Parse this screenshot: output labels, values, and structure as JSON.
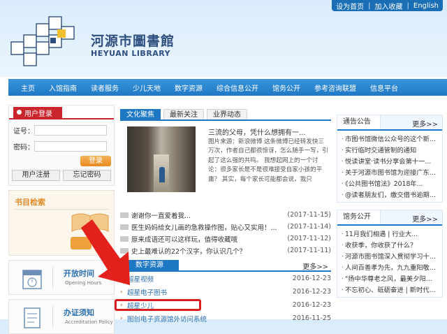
{
  "top_links": [
    "设为首页",
    "加入收藏",
    "English"
  ],
  "logo": {
    "name_cn": "河源市圖書館",
    "name_en": "HEYUAN LIBRARY"
  },
  "nav": [
    "主页",
    "入馆指南",
    "读者服务",
    "少儿天地",
    "数字资源",
    "综合信息公开",
    "馆务公开",
    "参考咨询联盟",
    "信息平台"
  ],
  "login": {
    "title": "用户登录",
    "card_label": "证号：",
    "password_label": "密码：",
    "login_button": "登录",
    "register_button": "用户注册",
    "forgot_button": "忘记密码"
  },
  "catalog": {
    "title": "书目检索"
  },
  "opening_hours": {
    "title": "开放时间",
    "subtitle": "Opening Hours"
  },
  "accreditation": {
    "title": "办证须知",
    "subtitle": "Accreditation Policy"
  },
  "center_tabs": [
    "文化聚焦",
    "最新关注",
    "业界动态"
  ],
  "feature": {
    "title": "三流的父母，凭什么想拥有一...",
    "text": "图片来源：新浪微博    这条微博已经转发快三万次，作者自己都很惊讶，怎么随手一写，引起了这么强的共鸣。    我想起网上的一个讨论：很多家长是不是很难接受自家小孩的平庸？    其实，每个家长可能都会说，我只"
  },
  "news": [
    {
      "title": "谢谢你一直爱着我...",
      "date": "(2017-11-15)"
    },
    {
      "title": "医生妈妈给女儿画的急救操作图，贴心又实用！...",
      "date": "(2017-11-14)"
    },
    {
      "title": "原来成语还可以这样玩，值得收藏哦",
      "date": "(2017-11-12)"
    },
    {
      "title": "史上最难认的22个汉字，你认识几个？",
      "date": "(2017-11-11)"
    }
  ],
  "digital": {
    "title": "数字资源",
    "more": "更多>>",
    "items": [
      {
        "title": "超星视频",
        "date": "2016-12-23"
      },
      {
        "title": "超星电子图书",
        "date": "2016-12-23"
      },
      {
        "title": "超星少儿",
        "date": "2016-12-23"
      },
      {
        "title": "图创电子资源馆外访问系统",
        "date": "2016-11-25"
      }
    ]
  },
  "notices": {
    "title": "通告公告",
    "more": "更多>>",
    "items": [
      "市图书馆微信公众号的这个新...",
      "实行临时交通管制的通知",
      "悦读讲堂·读书分享会第十一...",
      "关于河源市图书馆为迎接广东...",
      "《公共图书馆法》2018年...",
      "@读者朋友们，缴交借书逾期..."
    ]
  },
  "affairs": {
    "title": "馆务公开",
    "more": "更多>>",
    "items": [
      "11月我们相遇 | 行业大...",
      "收获季，你收获了什么？",
      "河源市图书馆深入贯彻学习十...",
      "人间百善孝为先，九九重阳敬...",
      "\"扬中华尊老之风，最美夕阳...",
      "不忘初心、砥砺奋进 | 新时代..."
    ]
  },
  "colors": {
    "nav_blue": "#1f78c4",
    "login_red": "#c9252c",
    "highlight_red": "#d81e1e",
    "button_orange": "#e8891e"
  }
}
